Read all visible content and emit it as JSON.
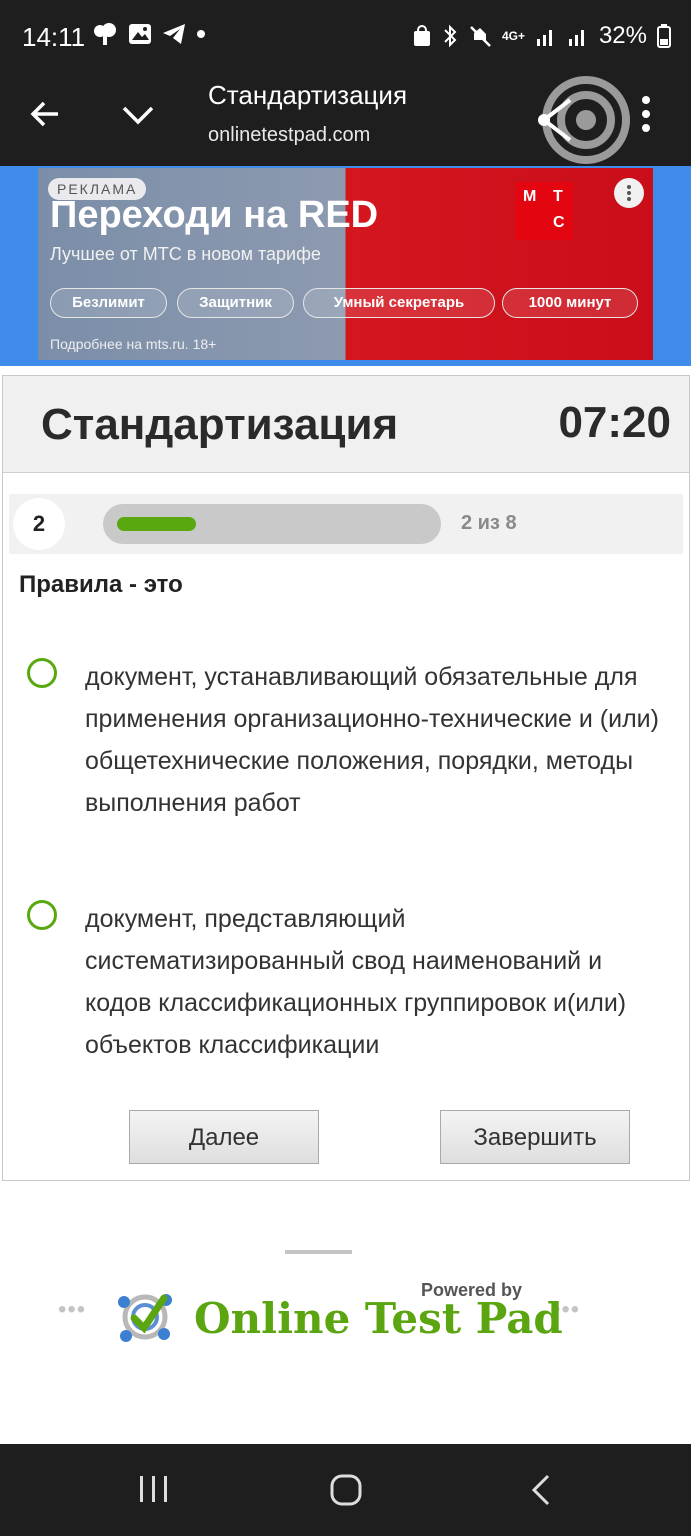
{
  "status_bar": {
    "time": "14:11",
    "signal": "4G+",
    "battery": "32%"
  },
  "browser": {
    "title": "Стандартизация",
    "url": "onlinetestpad.com"
  },
  "ad": {
    "badge": "РЕКЛАМА",
    "headline": "Переходи на RED",
    "subheadline": "Лучшее от МТС в новом тарифе",
    "pills": [
      "Безлимит",
      "Защитник",
      "Умный секретарь",
      "1000 минут"
    ],
    "footer": "Подробнее на mts.ru. 18+",
    "logo_letters": [
      "М",
      "Т",
      "С"
    ],
    "colors": {
      "background": "#3f8ceb",
      "brand_red": "#e30611"
    }
  },
  "quiz": {
    "title": "Стандартизация",
    "timer": "07:20",
    "question_number": "2",
    "progress_counter": "2 из 8",
    "progress_fraction": 0.25,
    "question": "Правила - это",
    "options": [
      "документ, устанавливающий обязательные для применения организационно-технические и (или) общетехнические положения, порядки, методы выполнения работ",
      "документ, представляющий систематизированный свод наименований и кодов классификационных группировок и(или) объектов классификации"
    ],
    "next_button": "Далее",
    "finish_button": "Завершить",
    "accent_color": "#59a80f"
  },
  "footer": {
    "powered_by": "Powered by",
    "brand": "Online Test Pad",
    "dots": "•••"
  }
}
